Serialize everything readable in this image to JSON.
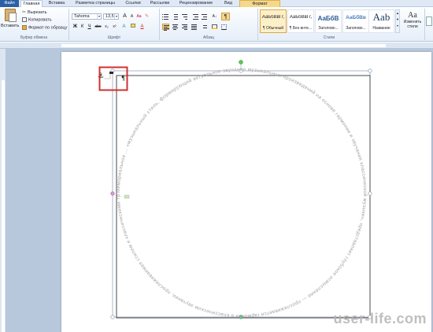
{
  "tabs": {
    "file": "Файл",
    "home": "Главная",
    "insert": "Вставка",
    "layout": "Разметка страницы",
    "refs": "Ссылки",
    "mail": "Рассылки",
    "review": "Рецензирование",
    "view": "Вид",
    "format": "Формат"
  },
  "clipboard": {
    "paste": "Вставить",
    "cut": "Вырезать",
    "copy": "Копировать",
    "format_painter": "Формат по образцу",
    "group_label": "Буфер обмена"
  },
  "font": {
    "name": "Tahoma",
    "size": "13,5",
    "group_label": "Шрифт",
    "bold": "Ж",
    "italic": "К",
    "underline": "Ч",
    "strike": "abc",
    "subscript": "x₂",
    "superscript": "x²",
    "color_a": "A"
  },
  "paragraph": {
    "group_label": "Абзац",
    "marks": "¶"
  },
  "styles": {
    "group_label": "Стили",
    "items": [
      {
        "sample": "АаБбВвГг,",
        "name": "¶ Обычный"
      },
      {
        "sample": "АаБбВвГг,",
        "name": "¶ Без инте..."
      },
      {
        "sample": "АаБбВ",
        "name": "Заголово..."
      },
      {
        "sample": "АаБбВв",
        "name": "Заголово..."
      },
      {
        "sample": "Aab",
        "name": "Название"
      }
    ],
    "change_styles": "Изменить стили"
  },
  "shape": {
    "circle_text": "Мемориальное ... «музыкальный стиль, формирующий актуальное звучание музыкальных произведений на основе гармонии и звучания классической музыки», представляет глубокое осмысление — прослеживается гармония в классическом звучании, прослеживаемая стилем и классическими традициями."
  },
  "watermark": "user-life.com",
  "colors": {
    "accent": "#2c5fa6",
    "highlight_box": "#d03030",
    "circle_text": "#a0a0a0"
  }
}
